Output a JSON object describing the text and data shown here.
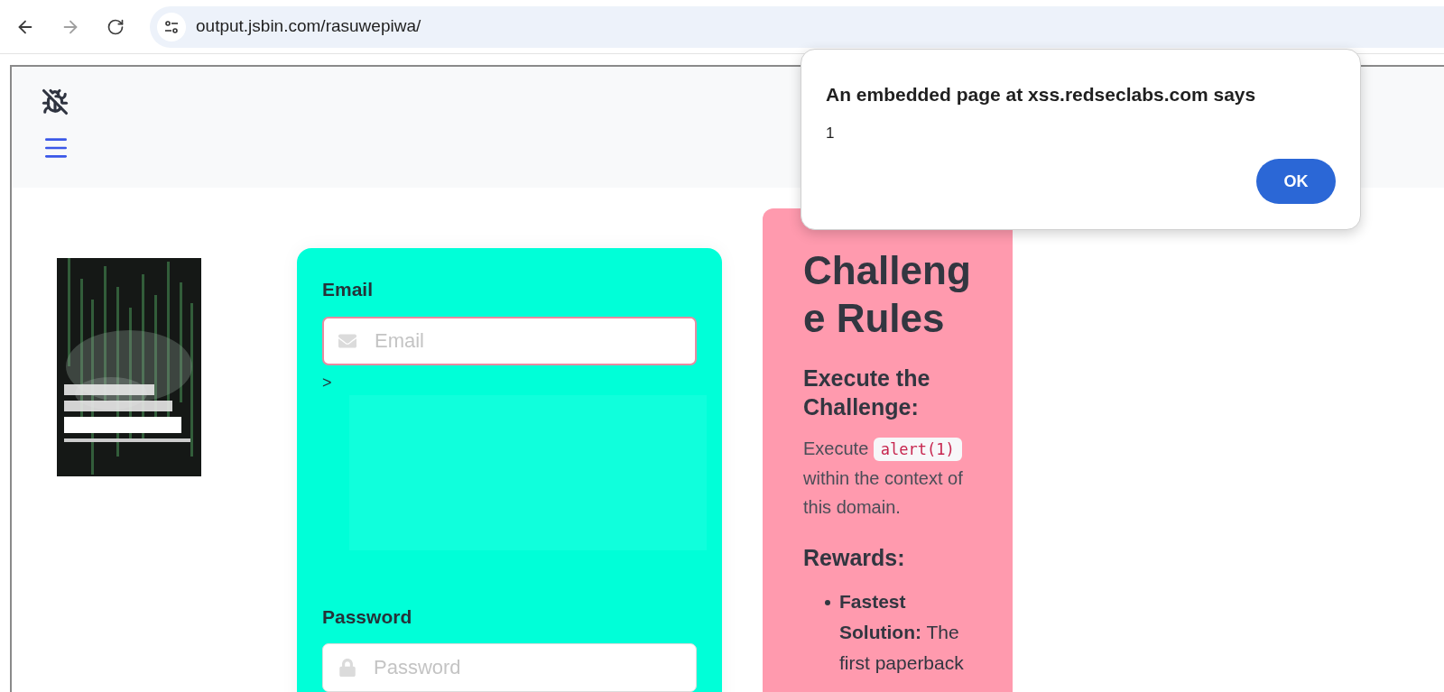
{
  "browser": {
    "nav_buttons": [
      {
        "kind": "back",
        "disabled": false
      },
      {
        "kind": "forward",
        "disabled": true
      },
      {
        "kind": "reload",
        "disabled": false
      }
    ],
    "url": "output.jsbin.com/rasuwepiwa/"
  },
  "page": {
    "login_form": {
      "fields": [
        {
          "label": "Email",
          "placeholder": "Email",
          "kind": "email",
          "focused": true,
          "after_text": ">"
        },
        {
          "label": "Password",
          "placeholder": "Password",
          "kind": "password",
          "focused": false
        }
      ]
    },
    "rules_card": {
      "title": "Challenge Rules",
      "sections": [
        {
          "heading": "Execute the Challenge:",
          "text_before": "Execute",
          "code": "alert(1)",
          "text_after": "within the context of this domain."
        },
        {
          "heading": "Rewards:",
          "items": [
            "**Fastest Solution:** The first paperback"
          ]
        }
      ]
    }
  },
  "dialog": {
    "title": "An embedded page at xss.redseclabs.com says",
    "message": "1",
    "buttons": [
      "OK"
    ]
  }
}
